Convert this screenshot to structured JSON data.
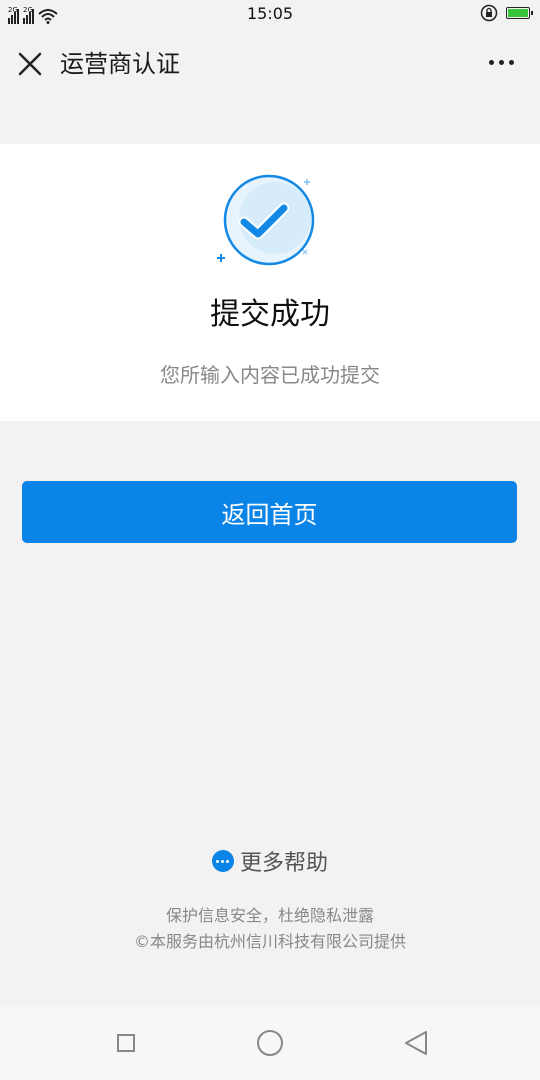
{
  "status_bar": {
    "time": "15:05",
    "signal_1_label": "2G",
    "signal_2_label": "2G",
    "icons": [
      "signal-icon",
      "signal-icon",
      "wifi-icon",
      "rotation-lock-icon",
      "battery-charging-icon"
    ]
  },
  "nav": {
    "title": "运营商认证",
    "close_icon": "close-icon",
    "more_icon": "more-icon"
  },
  "result": {
    "icon": "success-check-icon",
    "title": "提交成功",
    "description": "您所输入内容已成功提交"
  },
  "actions": {
    "home_label": "返回首页"
  },
  "help": {
    "icon": "more-help-icon",
    "label": "更多帮助"
  },
  "footer": {
    "line1": "保护信息安全，杜绝隐私泄露",
    "line2": "©本服务由杭州信川科技有限公司提供"
  },
  "system_nav": {
    "icons": [
      "recent-apps-icon",
      "home-icon",
      "back-icon"
    ]
  },
  "colors": {
    "accent": "#0a84e7",
    "background": "#f2f2f2",
    "card": "#ffffff",
    "icon_light": "#d6ecfb",
    "battery": "#36c53b"
  }
}
